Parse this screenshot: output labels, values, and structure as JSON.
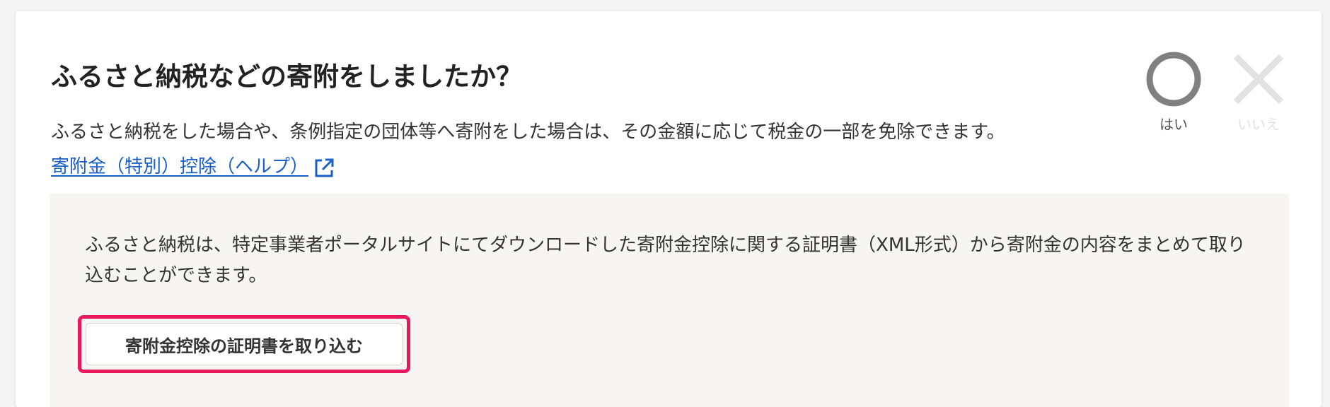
{
  "question": {
    "title": "ふるさと納税などの寄附をしましたか？",
    "description": "ふるさと納税をした場合や、条例指定の団体等へ寄附をした場合は、その金額に応じて税金の一部を免除できます。",
    "help_link": "寄附金（特別）控除（ヘルプ）",
    "help_icon": "external-link-icon"
  },
  "answers": {
    "yes": {
      "label": "はい",
      "icon": "circle-icon",
      "color": "#808080"
    },
    "no": {
      "label": "いいえ",
      "icon": "cross-icon",
      "color": "#e2e2e2"
    }
  },
  "info": {
    "text": "ふるさと納税は、特定事業者ポータルサイトにてダウンロードした寄附金控除に関する証明書（XML形式）から寄附金の内容をまとめて取り込むことができます。",
    "import_button": "寄附金控除の証明書を取り込む",
    "highlight_color": "#e8185d"
  },
  "colors": {
    "link": "#1a5fc8",
    "info_background": "#f6f5f3"
  }
}
